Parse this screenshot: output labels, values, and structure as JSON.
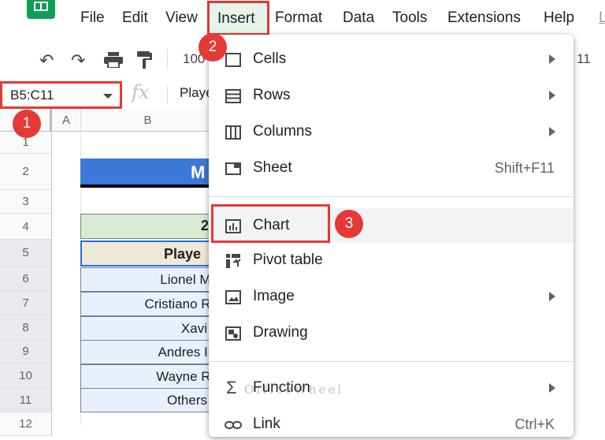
{
  "menubar": {
    "items": [
      "File",
      "Edit",
      "View",
      "Insert",
      "Format",
      "Data",
      "Tools",
      "Extensions",
      "Help",
      "L"
    ],
    "active": "Insert"
  },
  "toolbar": {
    "zoom_partial": "100",
    "font_size_partial": "11"
  },
  "formula_bar": {
    "name_box": "B5:C11",
    "fx": "fx",
    "content_partial": "Playe"
  },
  "grid": {
    "columns": [
      "A",
      "B"
    ],
    "rows": [
      "1",
      "2",
      "3",
      "4",
      "5",
      "6",
      "7",
      "8",
      "9",
      "10",
      "11",
      "12"
    ],
    "title_partial": "M",
    "header_row4_partial": "2",
    "header_row5_partial": "Playe",
    "players_partial": [
      "Lionel Me",
      "Cristiano Ro",
      "Xavi",
      "Andres Ini",
      "Wayne Ro",
      "Others"
    ]
  },
  "insert_menu": {
    "items": [
      {
        "label": "Cells",
        "icon": "cells-icon",
        "submenu": true
      },
      {
        "label": "Rows",
        "icon": "rows-icon",
        "submenu": true
      },
      {
        "label": "Columns",
        "icon": "columns-icon",
        "submenu": true
      },
      {
        "label": "Sheet",
        "icon": "sheet-icon",
        "shortcut": "Shift+F11"
      },
      {
        "label": "Chart",
        "icon": "chart-icon"
      },
      {
        "label": "Pivot table",
        "icon": "pivot-table-icon"
      },
      {
        "label": "Image",
        "icon": "image-icon",
        "submenu": true
      },
      {
        "label": "Drawing",
        "icon": "drawing-icon"
      },
      {
        "label": "Function",
        "icon": "sigma-icon",
        "submenu": true
      },
      {
        "label": "Link",
        "icon": "link-icon",
        "shortcut": "Ctrl+K"
      }
    ]
  },
  "steps": [
    "1",
    "2",
    "3"
  ],
  "watermark": "OfficeWheel",
  "colors": {
    "highlight_red": "#e53935",
    "sheets_green": "#0f9d58",
    "title_blue": "#3c78d8",
    "header_green": "#d9ead3",
    "cell_blue": "#e8f0fe"
  }
}
